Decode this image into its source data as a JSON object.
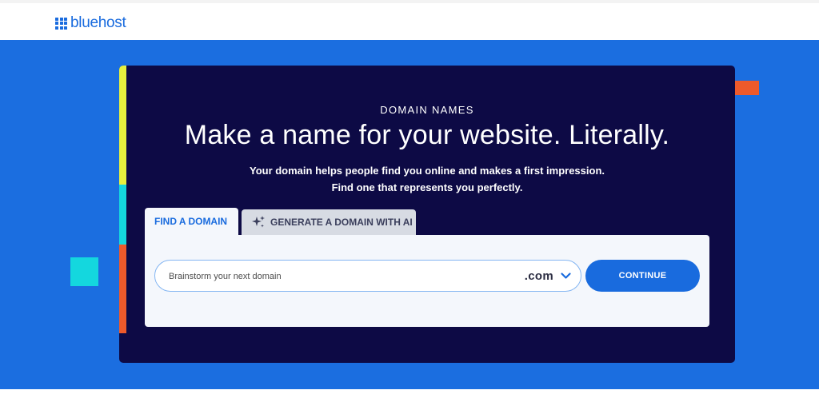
{
  "header": {
    "logo_text": "bluehost"
  },
  "hero": {
    "eyebrow": "DOMAIN NAMES",
    "title": "Make a name for your website. Literally.",
    "subtitle_line1": "Your domain helps people find you online and makes a first impression.",
    "subtitle_line2": "Find one that represents you perfectly."
  },
  "tabs": [
    {
      "label": "FIND A DOMAIN",
      "active": true
    },
    {
      "label": "GENERATE A DOMAIN WITH AI",
      "icon": "sparkle-icon",
      "active": false
    }
  ],
  "search": {
    "placeholder": "Brainstorm your next domain",
    "value": "",
    "tld": ".com",
    "tld_icon": "chevron-down-icon",
    "button_label": "CONTINUE"
  },
  "colors": {
    "brand_blue": "#196bde",
    "hero_background": "#1b6ee0",
    "card_background": "#0d0a45",
    "accent_yellow": "#e7f13e",
    "accent_cyan": "#14d7de",
    "accent_orange": "#ee5a2b"
  }
}
